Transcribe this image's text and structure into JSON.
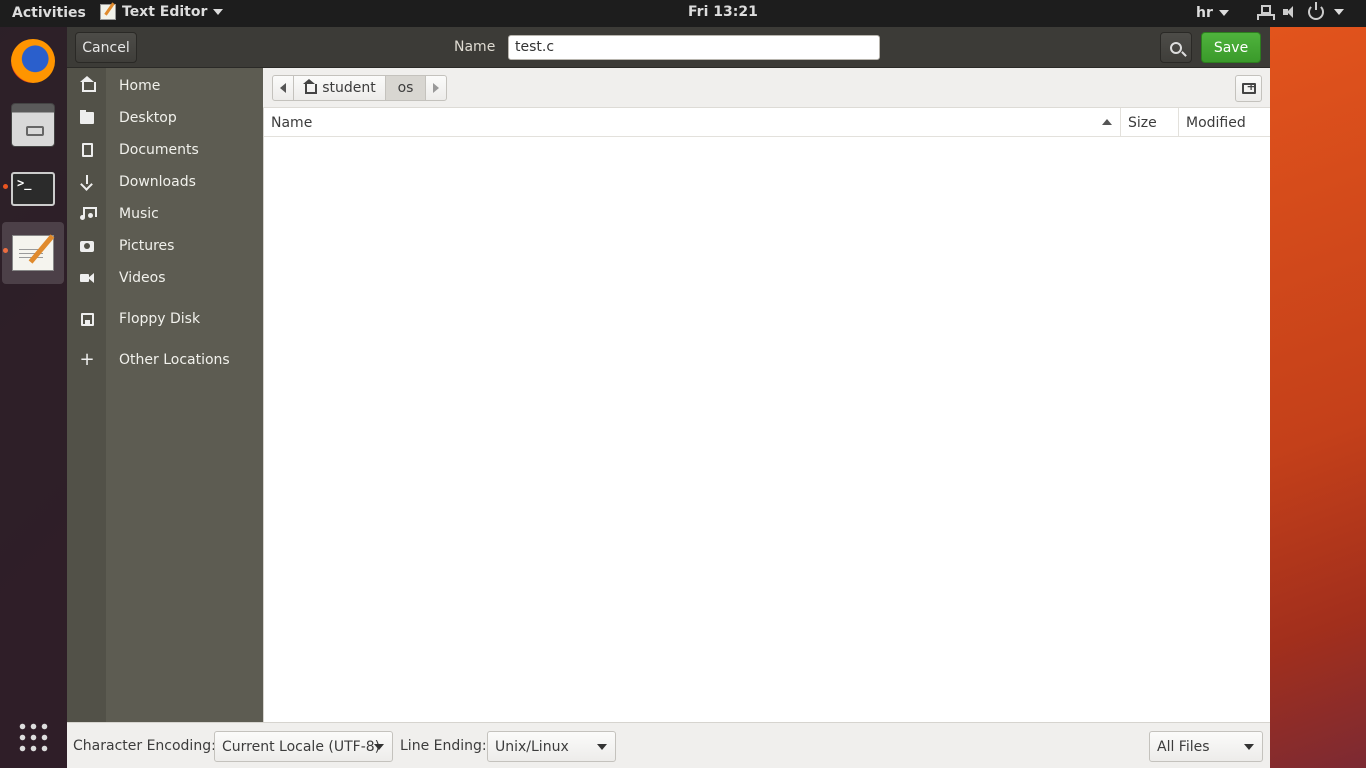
{
  "top_bar": {
    "activities": "Activities",
    "app_name": "Text Editor",
    "clock": "Fri 13:21",
    "keyboard_layout": "hr"
  },
  "dock": {
    "items": [
      "firefox",
      "files",
      "terminal",
      "text-editor"
    ],
    "terminal_glyph": ">_"
  },
  "dialog": {
    "cancel_label": "Cancel",
    "name_label": "Name",
    "filename": "test.c",
    "save_label": "Save",
    "accent_color": "#3a9a2a"
  },
  "sidebar": {
    "items": [
      {
        "label": "Home",
        "icon": "home-icon"
      },
      {
        "label": "Desktop",
        "icon": "folder-icon"
      },
      {
        "label": "Documents",
        "icon": "document-icon"
      },
      {
        "label": "Downloads",
        "icon": "download-icon"
      },
      {
        "label": "Music",
        "icon": "music-icon"
      },
      {
        "label": "Pictures",
        "icon": "camera-icon"
      },
      {
        "label": "Videos",
        "icon": "video-icon"
      },
      {
        "label": "Floppy Disk",
        "icon": "floppy-icon"
      },
      {
        "label": "Other Locations",
        "icon": "plus-icon"
      }
    ]
  },
  "path_bar": {
    "segments": [
      "student",
      "os"
    ],
    "current": "os"
  },
  "file_list": {
    "columns": [
      "Name",
      "Size",
      "Modified"
    ],
    "sort_column": "Name",
    "rows": []
  },
  "bottom_bar": {
    "encoding_label": "Character Encoding:",
    "encoding_value": "Current Locale (UTF-8)",
    "line_ending_label": "Line Ending:",
    "line_ending_value": "Unix/Linux",
    "filter_value": "All Files"
  }
}
